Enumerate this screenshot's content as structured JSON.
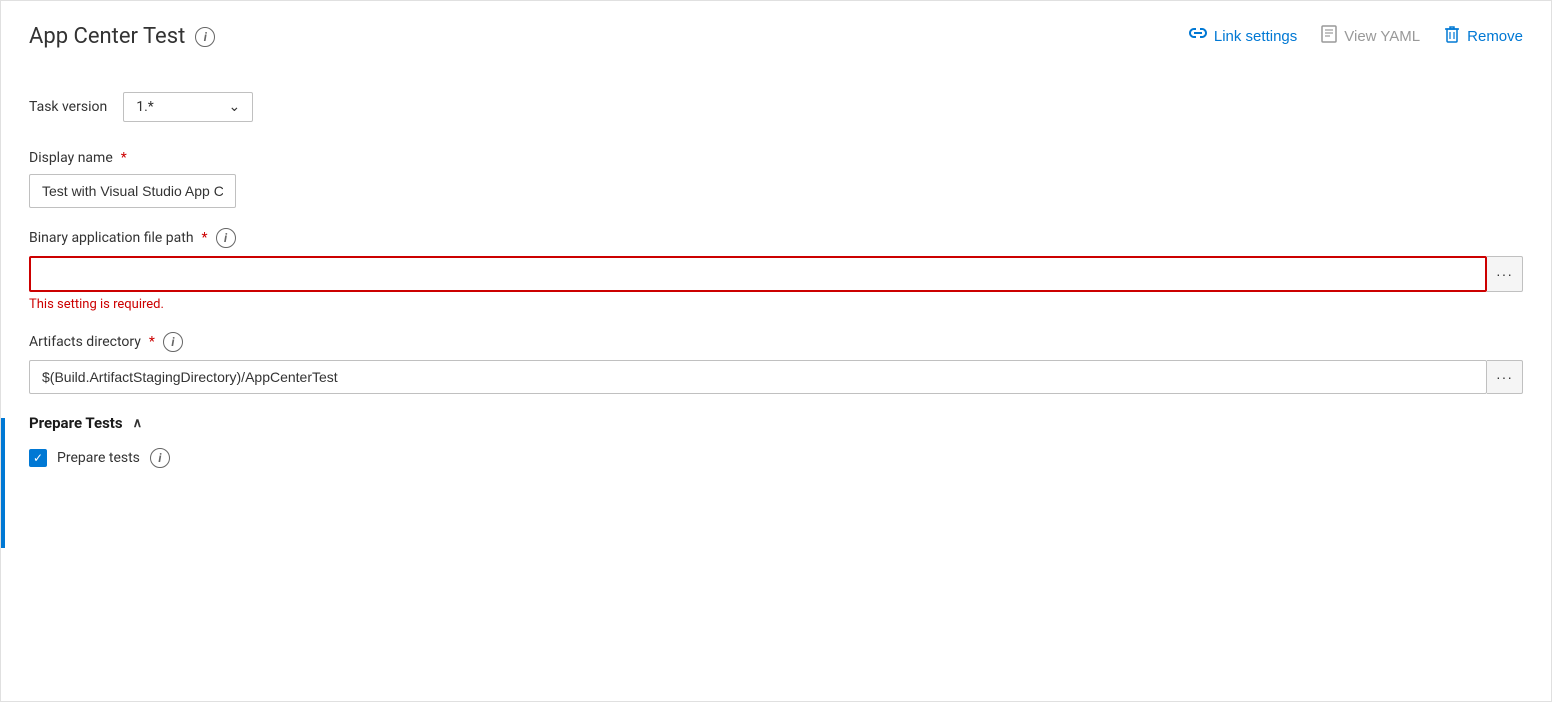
{
  "header": {
    "title": "App Center Test",
    "info_icon": "i",
    "actions": {
      "link_settings": {
        "label": "Link settings",
        "icon": "link",
        "disabled": false
      },
      "view_yaml": {
        "label": "View YAML",
        "icon": "yaml",
        "disabled": true
      },
      "remove": {
        "label": "Remove",
        "icon": "trash",
        "disabled": false
      }
    }
  },
  "form": {
    "task_version": {
      "label": "Task version",
      "value": "1.*"
    },
    "display_name": {
      "label": "Display name",
      "required": true,
      "value": "Test with Visual Studio App Center",
      "placeholder": ""
    },
    "binary_file_path": {
      "label": "Binary application file path",
      "required": true,
      "info": "i",
      "value": "",
      "placeholder": "",
      "error": "This setting is required.",
      "ellipsis": "···"
    },
    "artifacts_directory": {
      "label": "Artifacts directory",
      "required": true,
      "info": "i",
      "value": "$(Build.ArtifactStagingDirectory)/AppCenterTest",
      "placeholder": "",
      "ellipsis": "···"
    },
    "prepare_tests_section": {
      "label": "Prepare Tests",
      "collapse_icon": "∧"
    },
    "prepare_tests_checkbox": {
      "label": "Prepare tests",
      "info": "i",
      "checked": true
    }
  }
}
